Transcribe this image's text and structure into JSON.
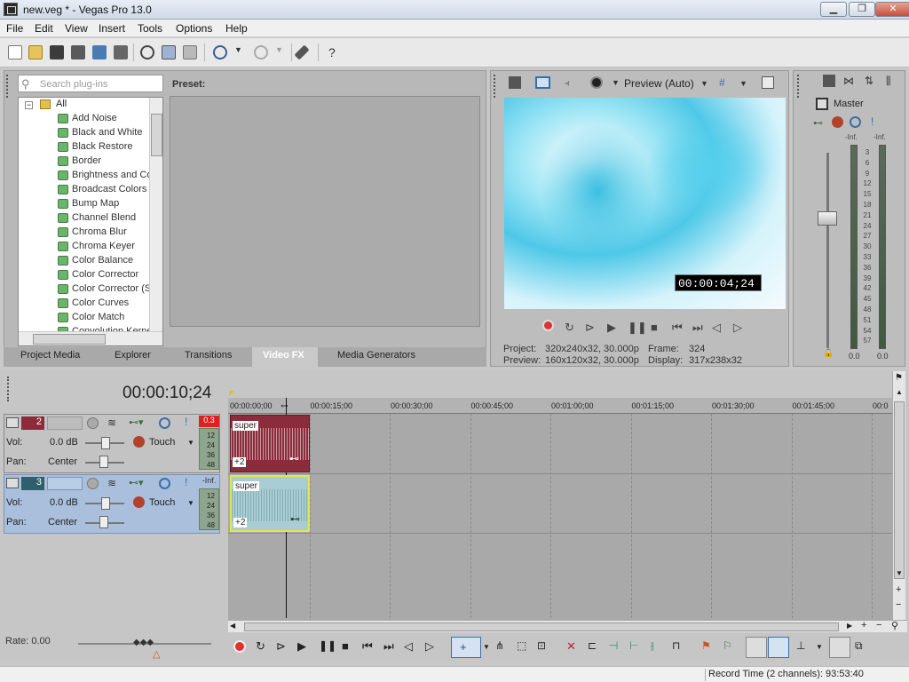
{
  "window": {
    "title": "new.veg * - Vegas Pro 13.0",
    "minimize": "▁",
    "maximize": "❐",
    "close": "✕"
  },
  "menu": [
    "File",
    "Edit",
    "View",
    "Insert",
    "Tools",
    "Options",
    "Help"
  ],
  "plugins": {
    "search_placeholder": "Search plug-ins",
    "preset_label": "Preset:",
    "root": "All",
    "items": [
      "Add Noise",
      "Black and White",
      "Black Restore",
      "Border",
      "Brightness and Co",
      "Broadcast Colors",
      "Bump Map",
      "Channel Blend",
      "Chroma Blur",
      "Chroma Keyer",
      "Color Balance",
      "Color Corrector",
      "Color Corrector (S",
      "Color Curves",
      "Color Match",
      "Convolution Kerne"
    ]
  },
  "tabs": [
    "Project Media",
    "Explorer",
    "Transitions",
    "Video FX",
    "Media Generators"
  ],
  "active_tab": "Video FX",
  "preview": {
    "mode": "Preview (Auto)",
    "timecode": "00:00:04;24",
    "project_label": "Project:",
    "project_value": "320x240x32, 30.000p",
    "preview_label": "Preview:",
    "preview_value": "160x120x32, 30.000p",
    "frame_label": "Frame:",
    "frame_value": "324",
    "display_label": "Display:",
    "display_value": "317x238x32"
  },
  "mixer": {
    "title": "Master",
    "inf_left": "-Inf.",
    "inf_right": "-Inf.",
    "scale": [
      "3",
      "6",
      "9",
      "12",
      "15",
      "18",
      "21",
      "24",
      "27",
      "30",
      "33",
      "36",
      "39",
      "42",
      "45",
      "48",
      "51",
      "54",
      "57"
    ],
    "bottom_left": "0.0",
    "bottom_right": "0.0"
  },
  "timeline": {
    "cursor_time": "00:00:10;24",
    "ruler": [
      "00:00:00;00",
      "00:00:15;00",
      "00:00:30;00",
      "00:00:45;00",
      "00:01:00;00",
      "00:01:15;00",
      "00:01:30;00",
      "00:01:45;00",
      "00:0"
    ]
  },
  "tracks": [
    {
      "number": "2",
      "vol_label": "Vol:",
      "vol": "0.0 dB",
      "pan_label": "Pan:",
      "pan": "Center",
      "mode": "Touch",
      "peak": "0.3",
      "meter": [
        "12",
        "24",
        "36",
        "48"
      ],
      "clip_label": "super",
      "clip_badge": "+2",
      "color": "#8a2c3c"
    },
    {
      "number": "3",
      "vol_label": "Vol:",
      "vol": "0.0 dB",
      "pan_label": "Pan:",
      "pan": "Center",
      "mode": "Touch",
      "peak": "-Inf.",
      "meter": [
        "12",
        "24",
        "36",
        "48"
      ],
      "clip_label": "super",
      "clip_badge": "+2",
      "color": "#9fc4c8"
    }
  ],
  "footer": {
    "rate": "Rate: 0.00",
    "status": "Record Time (2 channels): 93:53:40"
  },
  "colors": {
    "accent": "#3d6fb5",
    "track_selected": "#a9bfdc",
    "clip_audio1": "#8a2c3c",
    "clip_audio2": "#a9cdd3"
  }
}
